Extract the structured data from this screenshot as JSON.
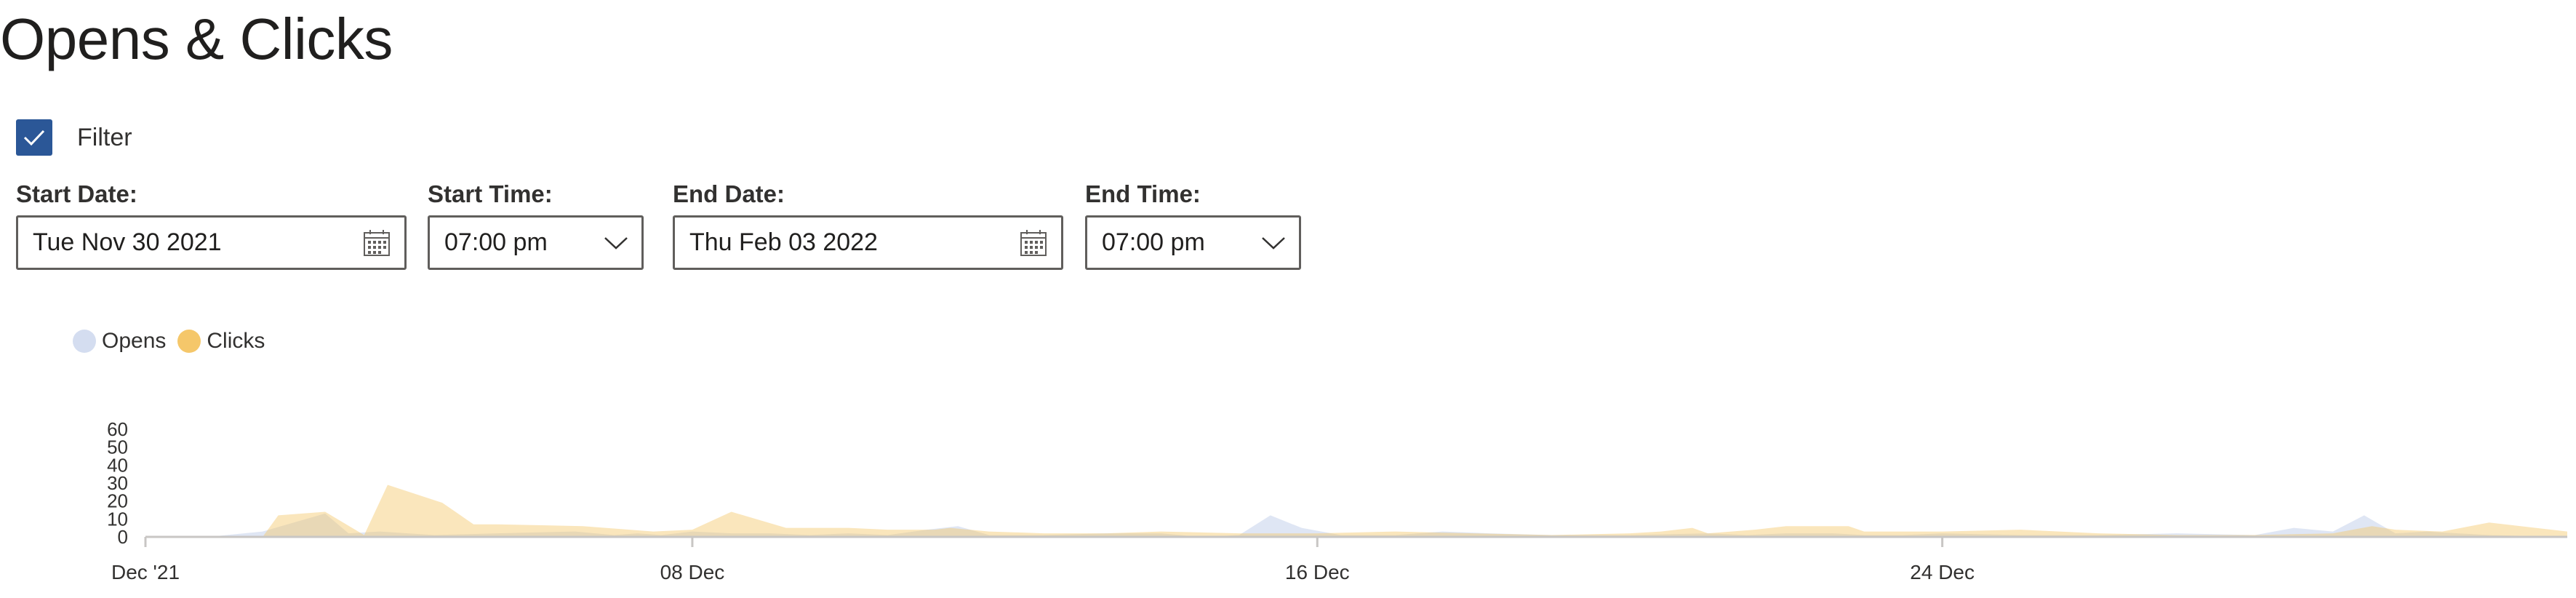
{
  "page": {
    "title": "Opens & Clicks"
  },
  "filter": {
    "checked": true,
    "label": "Filter"
  },
  "fields": {
    "start_date": {
      "label": "Start Date:",
      "value": "Tue Nov 30 2021"
    },
    "start_time": {
      "label": "Start Time:",
      "value": "07:00 pm"
    },
    "end_date": {
      "label": "End Date:",
      "value": "Thu Feb 03 2022"
    },
    "end_time": {
      "label": "End Time:",
      "value": "07:00 pm"
    }
  },
  "colors": {
    "opens": "#d4ddf0",
    "clicks": "#f5c76a",
    "checkbox": "#2b5797"
  },
  "chart_data": {
    "type": "area",
    "legend": [
      "Opens",
      "Clicks"
    ],
    "y_ticks": [
      "60",
      "50",
      "40",
      "30",
      "20",
      "10",
      "0"
    ],
    "x_ticks": [
      "Dec '21",
      "08 Dec",
      "16 Dec",
      "24 Dec"
    ],
    "ylim": [
      0,
      60
    ],
    "xlim": [
      0,
      31
    ],
    "series": [
      {
        "name": "Opens",
        "x": [
          0,
          0.8,
          1.5,
          2.3,
          2.6,
          3,
          3.7,
          4.5,
          5.5,
          6,
          6.3,
          6.6,
          7,
          7.5,
          8,
          8.5,
          9,
          9.5,
          10,
          10.4,
          10.8,
          11.5,
          12.3,
          13,
          13.5,
          14,
          14.4,
          14.8,
          15.3,
          16,
          16.6,
          17.2,
          18,
          19,
          20,
          20.5,
          21,
          21.6,
          22,
          22.5,
          23,
          24,
          25,
          26,
          27,
          27.5,
          28,
          28.4,
          28.8,
          29.2,
          29.6,
          30,
          31
        ],
        "y": [
          0,
          0,
          3,
          13,
          2,
          3,
          1,
          2,
          3,
          1,
          2,
          1,
          3,
          2,
          2,
          1,
          2,
          1,
          4,
          6,
          1,
          1,
          2,
          2,
          0,
          1,
          12,
          5,
          1,
          1,
          3,
          2,
          1,
          1,
          2,
          1,
          2,
          2,
          1,
          1,
          2,
          1,
          1,
          2,
          1,
          5,
          3,
          12,
          2,
          3,
          2,
          1,
          0
        ]
      },
      {
        "name": "Clicks",
        "x": [
          0,
          1.5,
          1.7,
          2.3,
          2.8,
          3.1,
          3.8,
          4.2,
          4.5,
          5.6,
          6.5,
          7,
          7.5,
          8.2,
          9,
          9.5,
          10.1,
          10.3,
          10.8,
          11.5,
          12.3,
          13,
          14,
          15,
          16,
          17,
          18,
          19,
          19.4,
          19.8,
          20,
          20.6,
          21,
          21.8,
          22,
          23,
          24,
          25,
          26,
          27,
          28,
          28.5,
          28.8,
          29.4,
          30,
          31
        ],
        "y": [
          0,
          0,
          12,
          14,
          1,
          29,
          19,
          7,
          7,
          6,
          3,
          4,
          14,
          5,
          5,
          4,
          4,
          5,
          3,
          2,
          2,
          3,
          2,
          2,
          3,
          2,
          1,
          2,
          3,
          5,
          2,
          4,
          6,
          6,
          3,
          3,
          4,
          2,
          1,
          1,
          2,
          6,
          4,
          3,
          8,
          3
        ]
      }
    ]
  }
}
